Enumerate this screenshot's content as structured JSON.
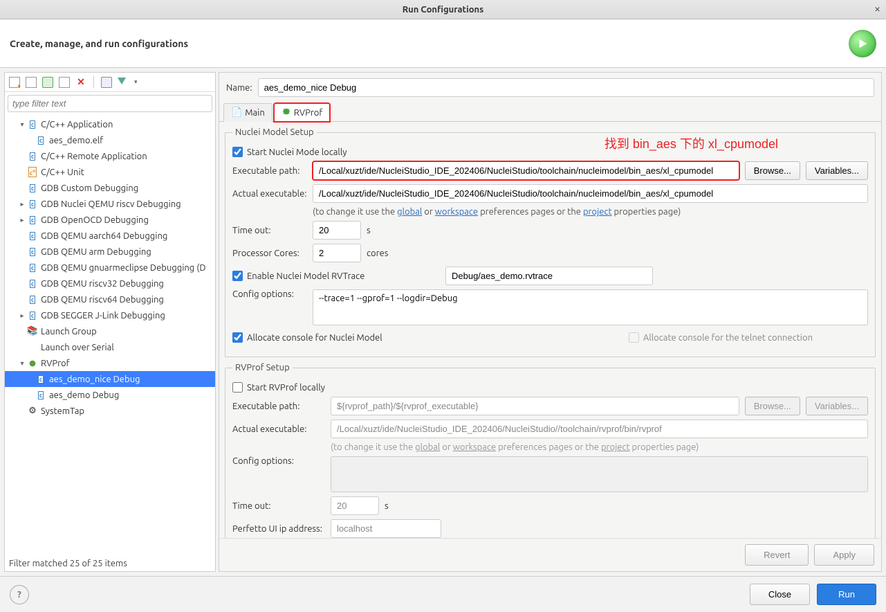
{
  "window": {
    "title": "Run Configurations"
  },
  "header": {
    "heading": "Create, manage, and run configurations"
  },
  "left": {
    "filter_placeholder": "type filter text",
    "tree": [
      {
        "label": "C/C++ Application",
        "icon": "c",
        "expandable": true,
        "expanded": true,
        "children": [
          {
            "label": "aes_demo.elf",
            "icon": "c"
          }
        ]
      },
      {
        "label": "C/C++ Remote Application",
        "icon": "c"
      },
      {
        "label": "C/C++ Unit",
        "icon": "cu"
      },
      {
        "label": "GDB Custom Debugging",
        "icon": "c"
      },
      {
        "label": "GDB Nuclei QEMU riscv Debugging",
        "icon": "c",
        "expandable": true
      },
      {
        "label": "GDB OpenOCD Debugging",
        "icon": "c",
        "expandable": true
      },
      {
        "label": "GDB QEMU aarch64 Debugging",
        "icon": "c"
      },
      {
        "label": "GDB QEMU arm Debugging",
        "icon": "c"
      },
      {
        "label": "GDB QEMU gnuarmeclipse Debugging (D",
        "icon": "c"
      },
      {
        "label": "GDB QEMU riscv32 Debugging",
        "icon": "c"
      },
      {
        "label": "GDB QEMU riscv64 Debugging",
        "icon": "c"
      },
      {
        "label": "GDB SEGGER J-Link Debugging",
        "icon": "c",
        "expandable": true
      },
      {
        "label": "Launch Group",
        "icon": "group"
      },
      {
        "label": "Launch over Serial",
        "icon": "none"
      },
      {
        "label": "RVProf",
        "icon": "bug",
        "expandable": true,
        "expanded": true,
        "children": [
          {
            "label": "aes_demo_nice Debug",
            "icon": "c",
            "selected": true
          },
          {
            "label": "aes_demo Debug",
            "icon": "c"
          }
        ]
      },
      {
        "label": "SystemTap",
        "icon": "sys"
      }
    ],
    "filter_status": "Filter matched 25 of 25 items"
  },
  "right": {
    "name_label": "Name:",
    "name_value": "aes_demo_nice Debug",
    "tabs": [
      {
        "label": "Main",
        "icon": "file"
      },
      {
        "label": "RVProf",
        "icon": "bug",
        "active": true,
        "highlight": true
      }
    ],
    "annotation_text": "找到 bin_aes 下的 xl_cpumodel",
    "nuclei": {
      "legend": "Nuclei Model Setup",
      "start_locally_label": "Start Nuclei Mode locally",
      "start_locally": true,
      "exec_path_label": "Executable path:",
      "exec_path": "/Local/xuzt/ide/NucleiStudio_IDE_202406/NucleiStudio/toolchain/nucleimodel/bin_aes/xl_cpumodel",
      "browse": "Browse...",
      "variables": "Variables...",
      "actual_exec_label": "Actual executable:",
      "actual_exec": "/Local/xuzt/ide/NucleiStudio_IDE_202406/NucleiStudio/toolchain/nucleimodel/bin_aes/xl_cpumodel",
      "hint_pre": "(to change it use the ",
      "hint_global": "global",
      "hint_or": " or ",
      "hint_workspace": "workspace",
      "hint_mid": " preferences pages or the ",
      "hint_project": "project",
      "hint_post": " properties page)",
      "timeout_label": "Time out:",
      "timeout": "20",
      "timeout_unit": "s",
      "cores_label": "Processor Cores:",
      "cores": "2",
      "cores_unit": "cores",
      "rvtrace_label": "Enable Nuclei Model RVTrace",
      "rvtrace_checked": true,
      "rvtrace_path": "Debug/aes_demo.rvtrace",
      "config_label": "Config options:",
      "config_value": "--trace=1 --gprof=1 --logdir=Debug",
      "alloc_console_label": "Allocate console for Nuclei Model",
      "alloc_console": true,
      "alloc_telnet_label": "Allocate console for the telnet connection",
      "alloc_telnet": false
    },
    "rvprof": {
      "legend": "RVProf Setup",
      "start_locally_label": "Start RVProf locally",
      "start_locally": false,
      "exec_path_label": "Executable path:",
      "exec_path": "${rvprof_path}/${rvprof_executable}",
      "browse": "Browse...",
      "variables": "Variables...",
      "actual_exec_label": "Actual executable:",
      "actual_exec": "/Local/xuzt/ide/NucleiStudio_IDE_202406/NucleiStudio//toolchain/rvprof/bin/rvprof",
      "config_label": "Config options:",
      "config_value": "",
      "timeout_label": "Time out:",
      "timeout": "20",
      "timeout_unit": "s",
      "perfetto_label": "Perfetto UI ip address:",
      "perfetto": "localhost"
    },
    "revert": "Revert",
    "apply": "Apply"
  },
  "footer": {
    "close": "Close",
    "run": "Run"
  }
}
